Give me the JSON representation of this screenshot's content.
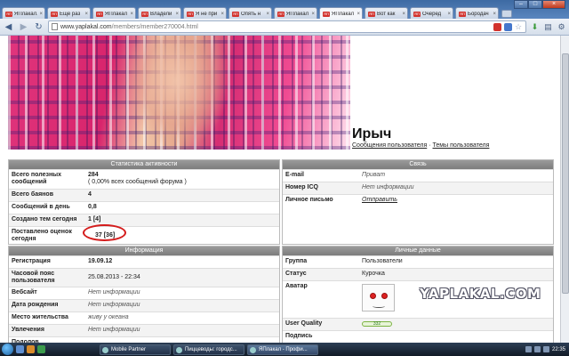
{
  "browser": {
    "tabs": [
      {
        "label": "ЯПлакал.com"
      },
      {
        "label": "Еще раз"
      },
      {
        "label": "ЯПлакал"
      },
      {
        "label": "Владели"
      },
      {
        "label": "Я не при"
      },
      {
        "label": "Опять н"
      },
      {
        "label": "ЯПлакал"
      },
      {
        "label": "ЯПлакал"
      },
      {
        "label": "Вот как"
      },
      {
        "label": "Очеред"
      },
      {
        "label": "Бородач"
      }
    ],
    "favicon_text": "ЯП",
    "url_host": "www.yaplakal.com",
    "url_path": "/members/member270004.html"
  },
  "profile": {
    "username": "Ирыч",
    "link_messages": "Сообщения пользователя",
    "separator": " · ",
    "link_topics": "Темы пользователя"
  },
  "activity": {
    "title": "Статистика активности",
    "rows": [
      {
        "key": "Всего полезных сообщений",
        "value": "284",
        "sub": "( 0,00% всех сообщений форума )"
      },
      {
        "key": "Всего баянов",
        "value": "4"
      },
      {
        "key": "Сообщений в день",
        "value": "0,8"
      },
      {
        "key": "Создано тем сегодня",
        "value": "1 [4]"
      },
      {
        "key": "Поставлено оценок сегодня",
        "value": "37 [36]"
      }
    ]
  },
  "info": {
    "title": "Информация",
    "rows": [
      {
        "key": "Регистрация",
        "value": "19.09.12"
      },
      {
        "key": "Часовой пояс пользователя",
        "value": "25.08.2013 - 22:34"
      },
      {
        "key": "Вебсайт",
        "value": "Нет информации"
      },
      {
        "key": "Дата рождения",
        "value": "Нет информации"
      },
      {
        "key": "Место жительства",
        "value": "живу у океана"
      },
      {
        "key": "Увлечения",
        "value": "Нет информации"
      },
      {
        "key": "Подолов",
        "value": ""
      }
    ]
  },
  "contact": {
    "title": "Связь",
    "rows": [
      {
        "key": "E-mail",
        "value": "Приват"
      },
      {
        "key": "Номер ICQ",
        "value": "Нет информации"
      },
      {
        "key": "Личное письмо",
        "value": "Отправить"
      }
    ]
  },
  "personal": {
    "title": "Личные данные",
    "rows": [
      {
        "key": "Группа",
        "value": "Пользователи"
      },
      {
        "key": "Статус",
        "value": "Курочка"
      },
      {
        "key": "Аватар",
        "value": ""
      },
      {
        "key": "User Quality",
        "value": "332"
      },
      {
        "key": "Подпись",
        "value": ""
      }
    ]
  },
  "watermark": "YAPLAKAL.COM",
  "taskbar": {
    "items": [
      {
        "label": "Mobile Partner"
      },
      {
        "label": "Пиццеводы: городс..."
      },
      {
        "label": "ЯПлакал - Профи..."
      }
    ],
    "clock": "22:35"
  }
}
